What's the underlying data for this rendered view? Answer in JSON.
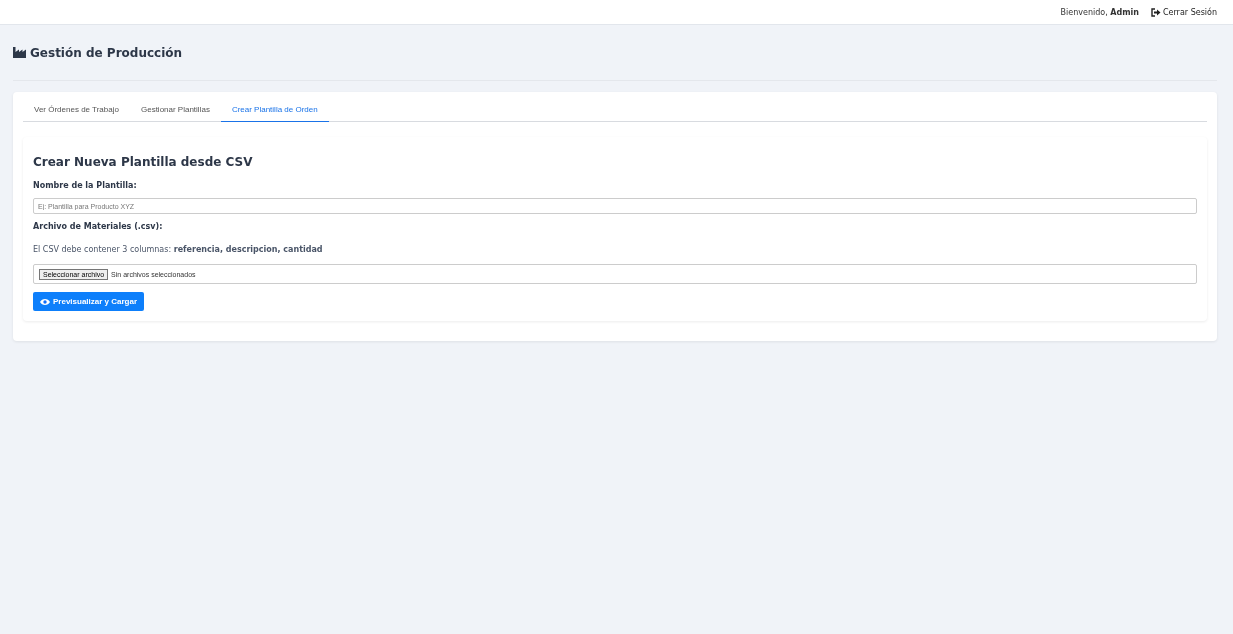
{
  "header": {
    "welcome": "Bienvenido, **Admin**",
    "logout": "Cerrar Sesión"
  },
  "page_title": "Gestión de Producción",
  "tabs": [
    {
      "label": "Ver Órdenes de Trabajo",
      "selected": false
    },
    {
      "label": "Gestionar Plantillas",
      "selected": false
    },
    {
      "label": "Crear Plantilla de Orden",
      "selected": true
    }
  ],
  "form": {
    "title": "Crear Nueva Plantilla desde CSV",
    "name_label": "Nombre de la Plantilla:",
    "name_placeholder": "Ej: Plantilla para Producto XYZ",
    "file_label": "Archivo de Materiales (.csv):",
    "hint": "El CSV debe contener 3 columnas: **referencia, descripcion, cantidad**",
    "file_button": "Seleccionar archivo",
    "file_status": "Sin archivos seleccionados",
    "submit": "Previsualizar y Cargar"
  }
}
